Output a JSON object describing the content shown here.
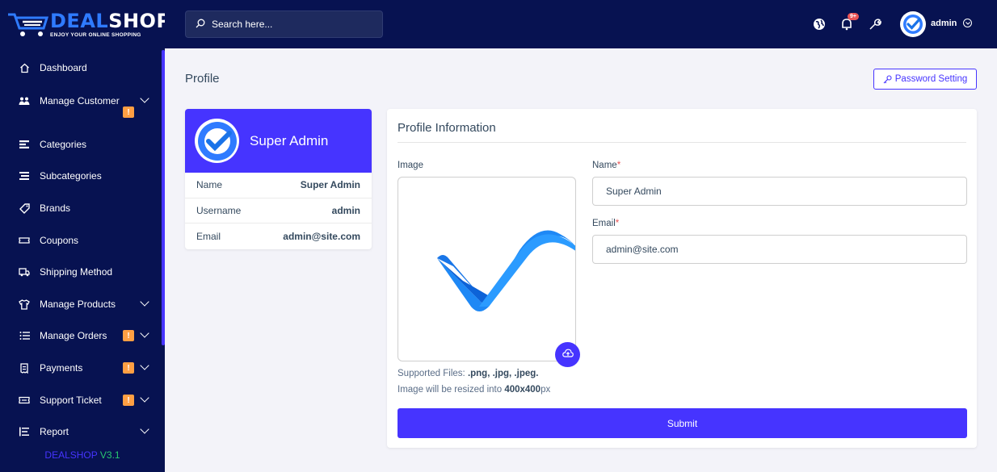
{
  "brand": {
    "name_part1": "DEAL",
    "name_part2": "SHOP",
    "tagline": "ENJOY YOUR ONLINE SHOPPING",
    "version_name": "DEALSHOP",
    "version_number": "V3.1"
  },
  "search": {
    "placeholder": "Search here..."
  },
  "topbar": {
    "notification_count": "9+",
    "user_name": "admin",
    "icons": [
      "globe-icon",
      "bell-icon",
      "wrench-icon",
      "avatar",
      "chevron-down-icon"
    ]
  },
  "sidebar": {
    "items": [
      {
        "label": "Dashboard",
        "icon": "home-icon",
        "has_chevron": false,
        "alert": ""
      },
      {
        "label": "Manage Customer",
        "icon": "users-icon",
        "has_chevron": true,
        "alert": "!"
      },
      {
        "label": "Categories",
        "icon": "categories-icon",
        "has_chevron": false,
        "alert": ""
      },
      {
        "label": "Subcategories",
        "icon": "subcategories-icon",
        "has_chevron": false,
        "alert": ""
      },
      {
        "label": "Brands",
        "icon": "tag-icon",
        "has_chevron": false,
        "alert": ""
      },
      {
        "label": "Coupons",
        "icon": "ticket-icon",
        "has_chevron": false,
        "alert": ""
      },
      {
        "label": "Shipping Method",
        "icon": "truck-icon",
        "has_chevron": false,
        "alert": ""
      },
      {
        "label": "Manage Products",
        "icon": "shirt-icon",
        "has_chevron": true,
        "alert": ""
      },
      {
        "label": "Manage Orders",
        "icon": "list-icon",
        "has_chevron": true,
        "alert": "!"
      },
      {
        "label": "Payments",
        "icon": "receipt-icon",
        "has_chevron": true,
        "alert": "!"
      },
      {
        "label": "Support Ticket",
        "icon": "ticket-alt-icon",
        "has_chevron": true,
        "alert": "!"
      },
      {
        "label": "Report",
        "icon": "report-icon",
        "has_chevron": true,
        "alert": ""
      }
    ]
  },
  "page": {
    "title": "Profile",
    "password_button": "Password Setting"
  },
  "profile_card": {
    "display_name": "Super Admin",
    "rows": [
      {
        "key": "Name",
        "value": "Super Admin"
      },
      {
        "key": "Username",
        "value": "admin"
      },
      {
        "key": "Email",
        "value": "admin@site.com"
      }
    ]
  },
  "form": {
    "title": "Profile Information",
    "image_label": "Image",
    "name_label": "Name",
    "name_value": "Super Admin",
    "email_label": "Email",
    "email_value": "admin@site.com",
    "required_mark": "*",
    "hint_supported_prefix": "Supported Files: ",
    "hint_supported_types": ".png, .jpg, .jpeg.",
    "hint_resize_prefix": "Image will be resized into ",
    "hint_resize_size": "400x400",
    "hint_resize_suffix": "px",
    "submit_label": "Submit"
  },
  "colors": {
    "primary": "#4634ff",
    "nav_bg": "#071251",
    "warning": "#ff9f43",
    "danger": "#ea5455",
    "brand_blue": "#2f7bff",
    "success": "#28c76f"
  }
}
